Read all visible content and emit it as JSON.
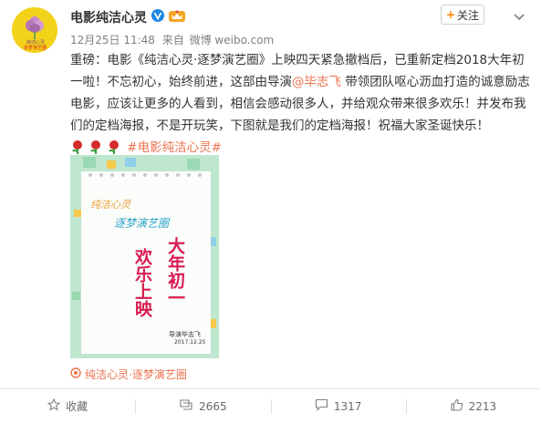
{
  "account": {
    "name": "电影纯洁心灵",
    "time": "12月25日 11:48",
    "from_prefix": "来自",
    "source": "微博 weibo.com",
    "follow_label": "关注",
    "avatar_caption": "纯洁心灵",
    "avatar_subcaption": "逐梦演艺圈"
  },
  "post": {
    "text_1": "重磅：电影《纯洁心灵·逐梦演艺圈》上映四天紧急撤档后，已重新定档2018大年初一啦！不忘初心，始终前进，这部由导演",
    "mention": "@毕志飞",
    "text_2": " 带领团队呕心沥血打造的诚意励志电影，应该让更多的人看到，相信会感动很多人，并给观众带来很多欢乐！并发布我们的定档海报，不是开玩笑，下图就是我们的定档海报！祝福大家圣诞快乐！",
    "hashtag": "#电影纯洁心灵#"
  },
  "poster": {
    "line_small_1": "纯洁心灵",
    "line_small_2": "逐梦演艺圈",
    "line_big_1": "大年初一",
    "line_big_2": "欢乐上映",
    "signature": "导演毕志飞",
    "sig_date": "2017.12.25"
  },
  "location": {
    "label": "纯洁心灵·逐梦演艺圈"
  },
  "actions": {
    "favorite": "收藏",
    "repost": "2665",
    "comment": "1317",
    "like": "2213"
  },
  "colors": {
    "link": "#eb7350",
    "follow_plus": "#ff8200",
    "avatar_bg": "#f3d21a",
    "poster_bg": "#bfe6cf"
  }
}
